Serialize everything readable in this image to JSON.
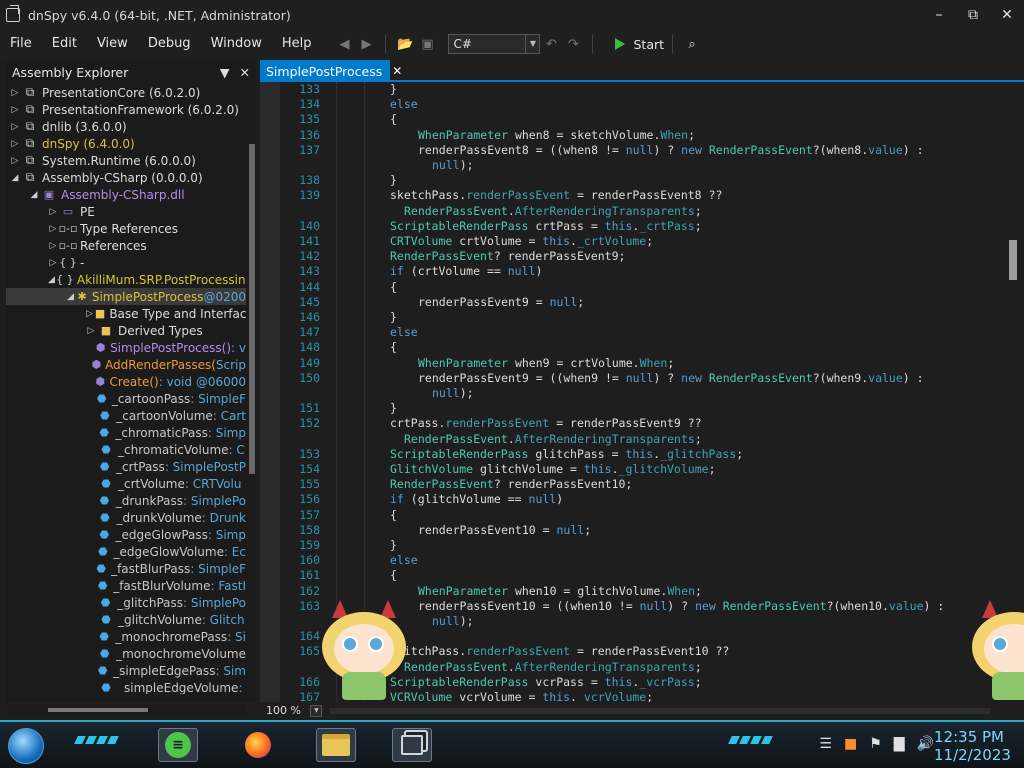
{
  "window": {
    "title": "dnSpy v6.4.0 (64-bit, .NET, Administrator)",
    "min_glyph": "✕",
    "max_glyph": "⧉",
    "close_glyph": "✕"
  },
  "menu": [
    "File",
    "Edit",
    "View",
    "Debug",
    "Window",
    "Help"
  ],
  "toolbar": {
    "language": "C#",
    "start_label": "Start"
  },
  "explorer": {
    "title": "Assembly Explorer",
    "nodes": [
      {
        "label": "PresentationCore (6.0.2.0)"
      },
      {
        "label": "PresentationFramework (6.0.2.0)"
      },
      {
        "label": "dnlib (3.6.0.0)"
      },
      {
        "label": "dnSpy (6.4.0.0)"
      },
      {
        "label": "System.Runtime (6.0.0.0)"
      },
      {
        "label": "Assembly-CSharp (0.0.0.0)"
      },
      {
        "label": "Assembly-CSharp.dll"
      },
      {
        "label": "PE"
      },
      {
        "label": "Type References"
      },
      {
        "label": "References"
      },
      {
        "label": "-"
      },
      {
        "label": "AkilliMum.SRP.PostProcessing"
      },
      {
        "label": "SimplePostProcess",
        "suffix": " @0200"
      },
      {
        "label": "Base Type and Interfac"
      },
      {
        "label": "Derived Types"
      },
      {
        "label": "SimplePostProcess()",
        "suffix": " : v"
      },
      {
        "label": "AddRenderPasses(",
        "suffix": "Scrip"
      },
      {
        "label": "Create()",
        "suffix": " : void @06000"
      },
      {
        "label": "_cartoonPass",
        "suffix": " : SimpleF"
      },
      {
        "label": "_cartoonVolume",
        "suffix": " : Cart"
      },
      {
        "label": "_chromaticPass",
        "suffix": " : Simp"
      },
      {
        "label": "_chromaticVolume",
        "suffix": " : C"
      },
      {
        "label": "_crtPass",
        "suffix": " : SimplePostP"
      },
      {
        "label": "_crtVolume",
        "suffix": " : CRTVolu"
      },
      {
        "label": "_drunkPass",
        "suffix": " : SimplePo"
      },
      {
        "label": "_drunkVolume",
        "suffix": " : Drunk"
      },
      {
        "label": "_edgeGlowPass",
        "suffix": " : Simp"
      },
      {
        "label": "_edgeGlowVolume",
        "suffix": " : Ec"
      },
      {
        "label": "_fastBlurPass",
        "suffix": " : SimpleF"
      },
      {
        "label": "_fastBlurVolume",
        "suffix": " : FastI"
      },
      {
        "label": "_glitchPass",
        "suffix": " : SimplePo"
      },
      {
        "label": "_glitchVolume",
        "suffix": " : Glitch"
      },
      {
        "label": "_monochromePass",
        "suffix": " : Si"
      },
      {
        "label": "_monochromeVolume",
        "suffix": ""
      },
      {
        "label": "_simpleEdgePass",
        "suffix": " : Sim"
      },
      {
        "label": "_simpleEdgeVolume",
        "suffix": " : "
      }
    ]
  },
  "editor": {
    "tab": "SimplePostProcess",
    "zoom": "100 %",
    "lines": [
      {
        "n": "133",
        "t": "}"
      },
      {
        "n": "134",
        "t": "else"
      },
      {
        "n": "135",
        "t": "{"
      },
      {
        "n": "136",
        "t": "WhenParameter when8 = sketchVolume.When;"
      },
      {
        "n": "137",
        "t": "renderPassEvent8 = ((when8 != null) ? new RenderPassEvent?(when8.value) :"
      },
      {
        "n": "",
        "t": "null);"
      },
      {
        "n": "138",
        "t": "}"
      },
      {
        "n": "139",
        "t": "sketchPass.renderPassEvent = renderPassEvent8 ??"
      },
      {
        "n": "",
        "t": "RenderPassEvent.AfterRenderingTransparents;"
      },
      {
        "n": "140",
        "t": "ScriptableRenderPass crtPass = this._crtPass;"
      },
      {
        "n": "141",
        "t": "CRTVolume crtVolume = this._crtVolume;"
      },
      {
        "n": "142",
        "t": "RenderPassEvent? renderPassEvent9;"
      },
      {
        "n": "143",
        "t": "if (crtVolume == null)"
      },
      {
        "n": "144",
        "t": "{"
      },
      {
        "n": "145",
        "t": "renderPassEvent9 = null;"
      },
      {
        "n": "146",
        "t": "}"
      },
      {
        "n": "147",
        "t": "else"
      },
      {
        "n": "148",
        "t": "{"
      },
      {
        "n": "149",
        "t": "WhenParameter when9 = crtVolume.When;"
      },
      {
        "n": "150",
        "t": "renderPassEvent9 = ((when9 != null) ? new RenderPassEvent?(when9.value) :"
      },
      {
        "n": "",
        "t": "null);"
      },
      {
        "n": "151",
        "t": "}"
      },
      {
        "n": "152",
        "t": "crtPass.renderPassEvent = renderPassEvent9 ??"
      },
      {
        "n": "",
        "t": "RenderPassEvent.AfterRenderingTransparents;"
      },
      {
        "n": "153",
        "t": "ScriptableRenderPass glitchPass = this._glitchPass;"
      },
      {
        "n": "154",
        "t": "GlitchVolume glitchVolume = this._glitchVolume;"
      },
      {
        "n": "155",
        "t": "RenderPassEvent? renderPassEvent10;"
      },
      {
        "n": "156",
        "t": "if (glitchVolume == null)"
      },
      {
        "n": "157",
        "t": "{"
      },
      {
        "n": "158",
        "t": "renderPassEvent10 = null;"
      },
      {
        "n": "159",
        "t": "}"
      },
      {
        "n": "160",
        "t": "else"
      },
      {
        "n": "161",
        "t": "{"
      },
      {
        "n": "162",
        "t": "WhenParameter when10 = glitchVolume.When;"
      },
      {
        "n": "163",
        "t": "renderPassEvent10 = ((when10 != null) ? new RenderPassEvent?(when10.value) :"
      },
      {
        "n": "",
        "t": "null);"
      },
      {
        "n": "164",
        "t": "}"
      },
      {
        "n": "165",
        "t": "glitchPass.renderPassEvent = renderPassEvent10 ??"
      },
      {
        "n": "",
        "t": "RenderPassEvent.AfterRenderingTransparents;"
      },
      {
        "n": "166",
        "t": "ScriptableRenderPass vcrPass = this._vcrPass;"
      },
      {
        "n": "167",
        "t": "VCRVolume vcrVolume = this._vcrVolume;"
      }
    ]
  },
  "taskbar": {
    "time": "12:35 PM",
    "date": "11/2/2023"
  }
}
